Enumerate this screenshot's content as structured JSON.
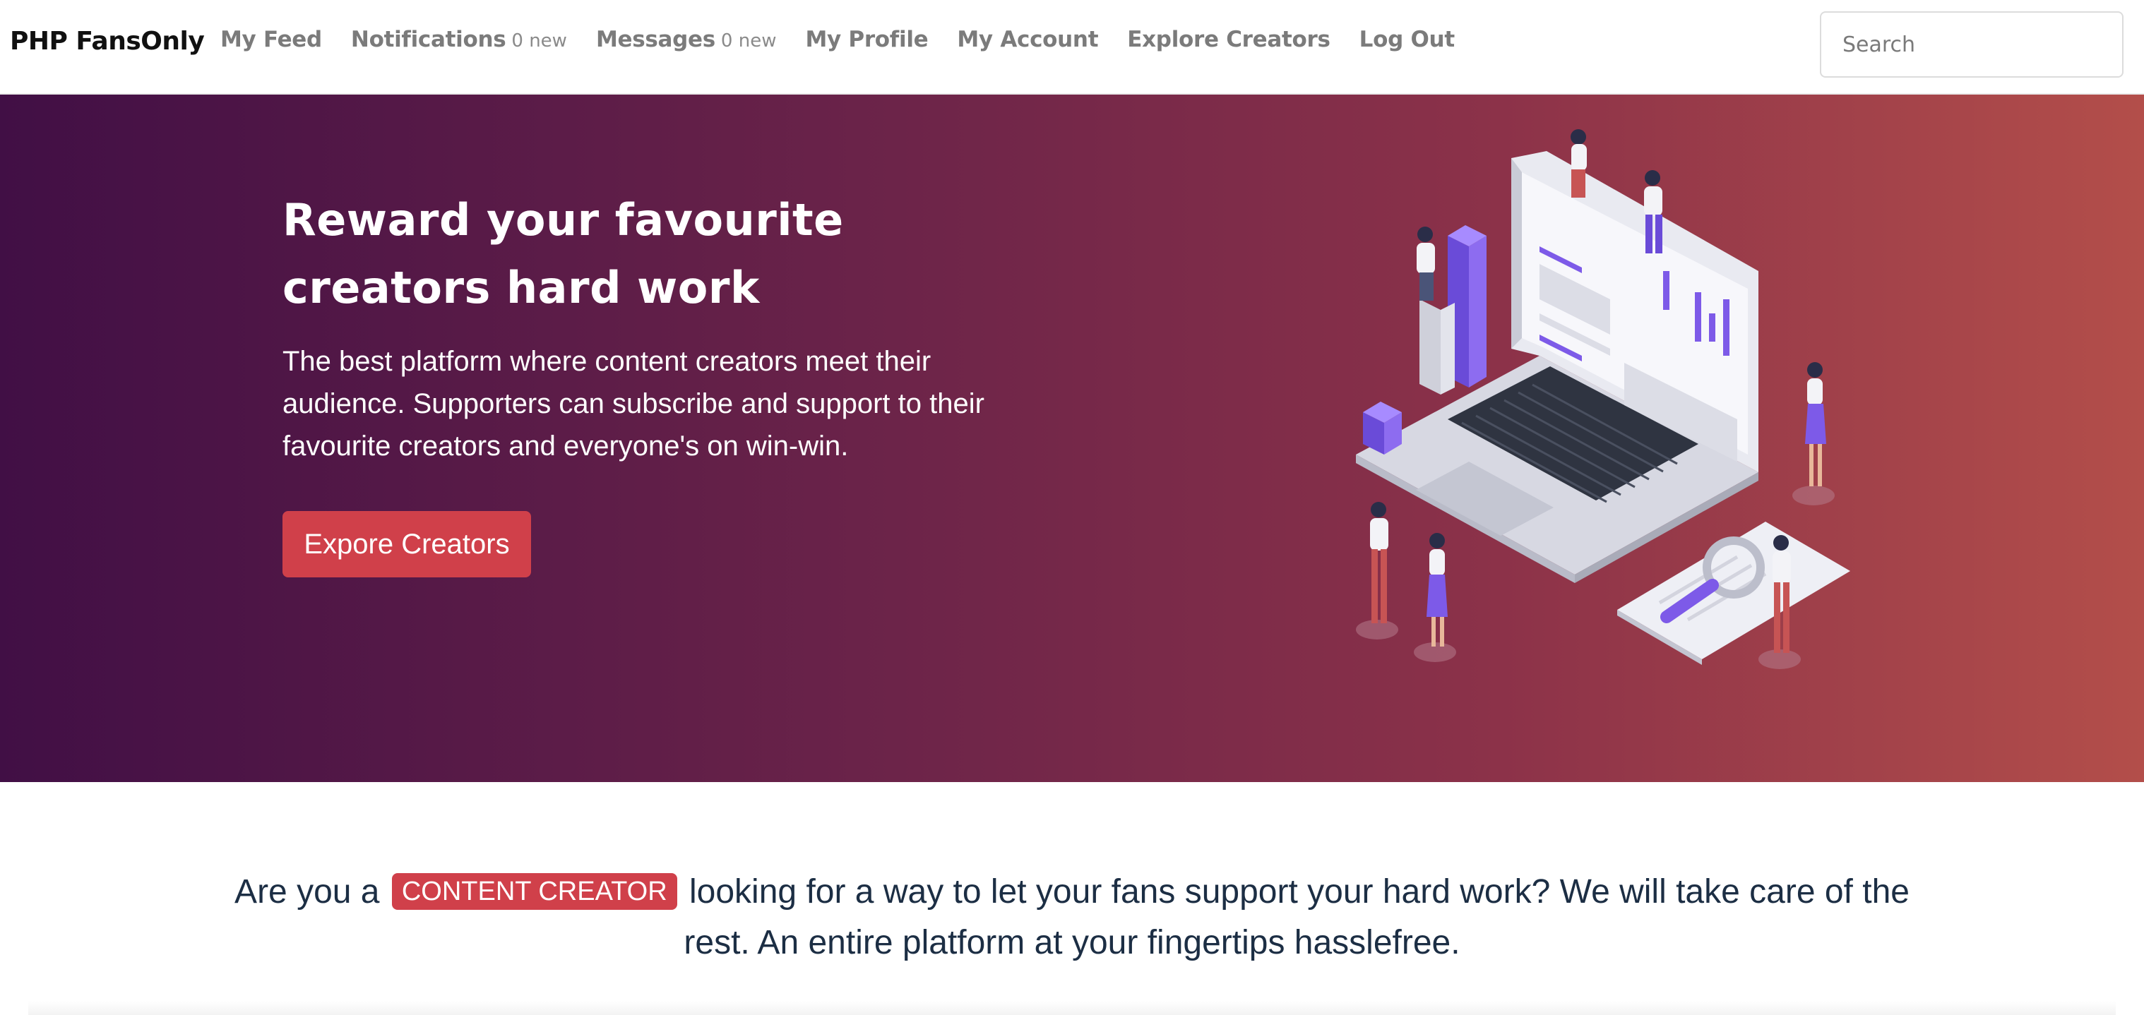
{
  "navbar": {
    "brand": "PHP FansOnly",
    "items": [
      {
        "label": "My Feed",
        "extra": ""
      },
      {
        "label": "Notifications",
        "extra": "0 new"
      },
      {
        "label": "Messages",
        "extra": "0 new"
      },
      {
        "label": "My Profile",
        "extra": ""
      },
      {
        "label": "My Account",
        "extra": ""
      },
      {
        "label": "Explore Creators",
        "extra": ""
      },
      {
        "label": "Log Out",
        "extra": ""
      }
    ],
    "search_placeholder": "Search"
  },
  "hero": {
    "title": "Reward your favourite creators hard work",
    "text": "The best platform where content creators meet their audience. Supporters can subscribe and support to their favourite creators and everyone's on win-win.",
    "button_label": "Expore Creators",
    "illustration": "laptop-with-people-illustration"
  },
  "tagline": {
    "prefix": "Are you a",
    "badge": "CONTENT CREATOR",
    "suffix": "looking for a way to let your fans support your hard work? We will take care of the rest. An entire platform at your fingertips hasslefree."
  },
  "colors": {
    "hero_gradient_start": "#410f45",
    "hero_gradient_end": "#b34e4a",
    "accent": "#d0404a",
    "tagline_text": "#1c2e44",
    "nav_text": "#7b7b7b"
  }
}
